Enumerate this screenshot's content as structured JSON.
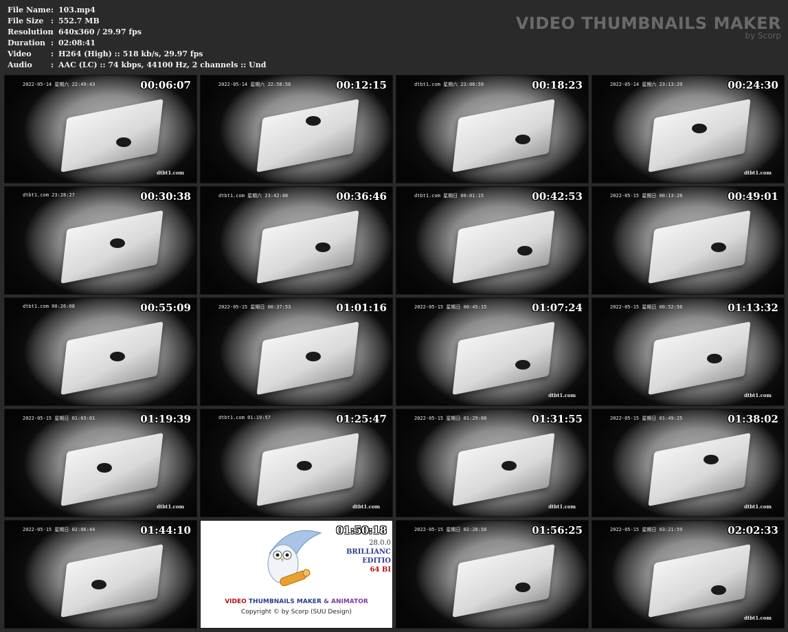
{
  "info": [
    {
      "key": "File Name",
      "sep": ":",
      "value": "103.mp4"
    },
    {
      "key": "File Size",
      "sep": ":",
      "value": "552.7 MB"
    },
    {
      "key": "Resolution",
      "sep": ":",
      "value": "640x360 / 29.97 fps"
    },
    {
      "key": "Duration",
      "sep": ":",
      "value": "02:08:41"
    },
    {
      "key": "Video",
      "sep": ":",
      "value": "H264 (High) :: 518 kb/s, 29.97 fps"
    },
    {
      "key": "Audio",
      "sep": ":",
      "value": "AAC (LC) :: 74 kbps, 44100 Hz, 2 channels :: Und"
    }
  ],
  "brand": {
    "title": "VIDEO THUMBNAILS MAKER",
    "subtitle": "by Scorp"
  },
  "thumbs": [
    {
      "time": "00:06:07",
      "stamp": "2022-05-14  星期六  22:49:43",
      "wm": "dtbt1.com"
    },
    {
      "time": "00:12:15",
      "stamp": "2022-05-14  星期六  22:58:56",
      "wm": ""
    },
    {
      "time": "00:18:23",
      "stamp": "dtbt1.com  星期六  23:06:59",
      "wm": ""
    },
    {
      "time": "00:24:30",
      "stamp": "2022-05-14  星期六  23:13:29",
      "wm": "dtbt1.com"
    },
    {
      "time": "00:30:38",
      "stamp": "dtbt1.com  23:28:27",
      "wm": ""
    },
    {
      "time": "00:36:46",
      "stamp": "dtbt1.com  星期六  23:42:48",
      "wm": ""
    },
    {
      "time": "00:42:53",
      "stamp": "dtbt1.com  星期日  00:01:15",
      "wm": ""
    },
    {
      "time": "00:49:01",
      "stamp": "2022-05-15  星期日  00:13:28",
      "wm": ""
    },
    {
      "time": "00:55:09",
      "stamp": "dtbt1.com  00:26:08",
      "wm": ""
    },
    {
      "time": "01:01:16",
      "stamp": "2022-05-15  星期日  00:37:53",
      "wm": ""
    },
    {
      "time": "01:07:24",
      "stamp": "2022-05-15  星期日  00:45:15",
      "wm": "dtbt1.com"
    },
    {
      "time": "01:13:32",
      "stamp": "2022-05-15  星期日  00:52:56",
      "wm": "dtbt1.com"
    },
    {
      "time": "01:19:39",
      "stamp": "2022-05-15  星期日  01:03:01",
      "wm": "dtbt1.com"
    },
    {
      "time": "01:25:47",
      "stamp": "dtbt1.com  01:19:57",
      "wm": "dtbt1.com"
    },
    {
      "time": "01:31:55",
      "stamp": "2022-05-15  星期日  01:29:08",
      "wm": "dtbt1.com"
    },
    {
      "time": "01:38:02",
      "stamp": "2022-05-15  星期日  01:49:25",
      "wm": "dtbt1.com"
    },
    {
      "time": "01:44:10",
      "stamp": "2022-05-15  星期日  02:06:44",
      "wm": ""
    },
    {
      "time": "01:50:18",
      "stamp": "",
      "wm": "",
      "logo": true
    },
    {
      "time": "01:56:25",
      "stamp": "2022-05-15  星期日  02:28:58",
      "wm": ""
    },
    {
      "time": "02:02:33",
      "stamp": "2022-05-15  星期日  03:21:59",
      "wm": "dtbt1.com"
    }
  ],
  "logo": {
    "version": "28.0.0",
    "edition1": "BRILLIANC",
    "edition2": "EDITIO",
    "bits": "64 BI",
    "title_a": "VIDEO ",
    "title_b": "THUMBNAILS MAKER ",
    "title_c": "& ANIMATOR",
    "copyright": "Copyright © by Scorp (SUU Design)"
  }
}
